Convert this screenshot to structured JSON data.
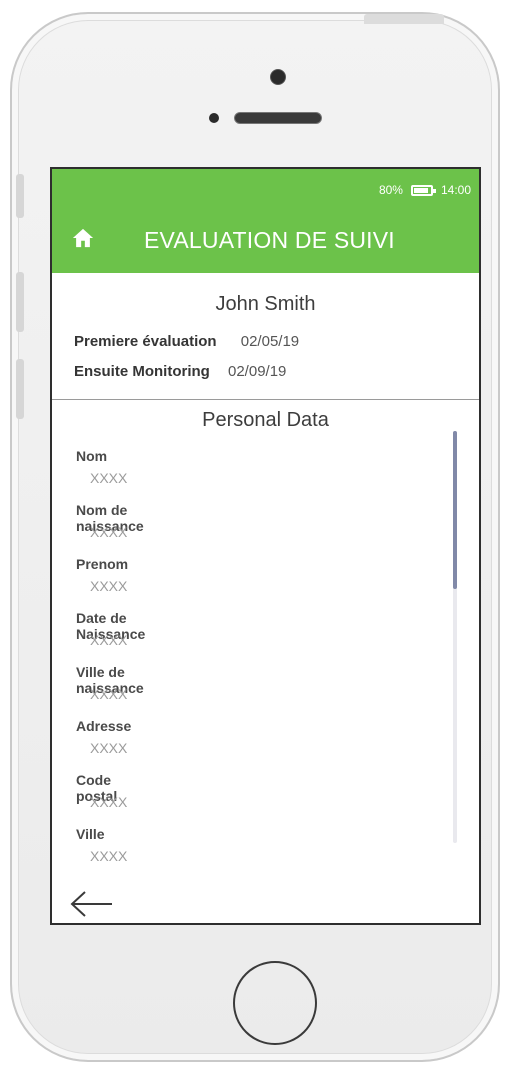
{
  "status_bar": {
    "battery_percent": "80%",
    "battery_icon": "battery-icon",
    "time": "14:00"
  },
  "app_bar": {
    "home_icon": "home-icon",
    "title": "EVALUATION DE SUIVI",
    "color": "#6cc24a"
  },
  "patient": {
    "name": "John Smith",
    "first_eval_label": "Premiere évaluation",
    "first_eval_date": "02/05/19",
    "monitoring_label": "Ensuite Monitoring",
    "monitoring_date": "02/09/19"
  },
  "personal_data": {
    "title": "Personal Data",
    "fields": [
      {
        "label": "Nom",
        "value": "XXXX"
      },
      {
        "label": "Nom de naissance",
        "value": "XXXX"
      },
      {
        "label": "Prenom",
        "value": "XXXX"
      },
      {
        "label": "Date de Naissance",
        "value": "XXXX"
      },
      {
        "label": "Ville de naissance",
        "value": "XXXX"
      },
      {
        "label": "Adresse",
        "value": "XXXX"
      },
      {
        "label": "Code postal",
        "value": "XXXX"
      },
      {
        "label": "Ville",
        "value": "XXXX"
      }
    ]
  },
  "navigation": {
    "back_icon": "arrow-left-icon"
  }
}
